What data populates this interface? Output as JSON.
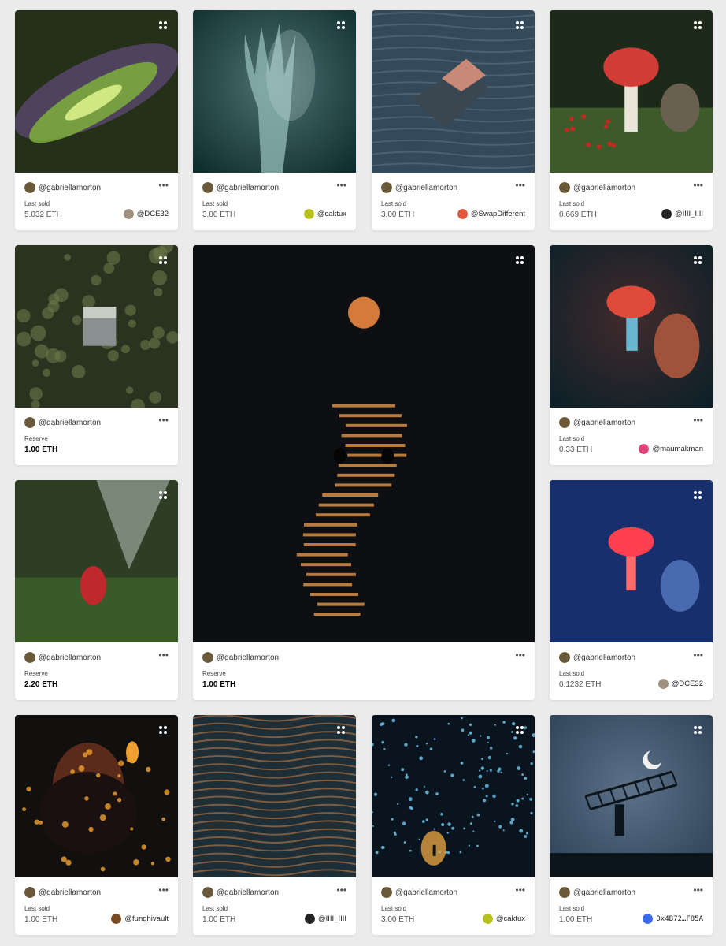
{
  "colors": {
    "background": "#ebebeb",
    "card": "#ffffff",
    "reserve_text": "#000000",
    "last_sold_text": "#555555"
  },
  "cards": [
    {
      "id": "aurora",
      "creator": "@gabriellamorton",
      "label": "Last sold",
      "price": "5.032 ETH",
      "owner": "@DCE32",
      "owner_avatar": "#a09080",
      "palette": [
        "#243018",
        "#7fae3c",
        "#6a4e8a"
      ],
      "art": "aurora"
    },
    {
      "id": "hand",
      "creator": "@gabriellamorton",
      "label": "Last sold",
      "price": "3.00 ETH",
      "owner": "@caktux",
      "owner_avatar": "#b8c020",
      "palette": [
        "#0f2e30",
        "#8fb6b4",
        "#163a3c"
      ],
      "art": "hand"
    },
    {
      "id": "bed-water",
      "creator": "@gabriellamorton",
      "label": "Last sold",
      "price": "3.00 ETH",
      "owner": "@SwapDifferent",
      "owner_avatar": "#e2583e",
      "palette": [
        "#344a5a",
        "#5d7282",
        "#c88a76"
      ],
      "art": "bed-water"
    },
    {
      "id": "mushroom-1",
      "creator": "@gabriellamorton",
      "label": "Last sold",
      "price": "0.669 ETH",
      "owner": "@IIII_IIII",
      "owner_avatar": "#222222",
      "palette": [
        "#1d2a1a",
        "#d23c36",
        "#3d5a2a"
      ],
      "art": "mushroom"
    },
    {
      "id": "bed-forest",
      "creator": "@gabriellamorton",
      "label": "Reserve",
      "price": "1.00 ETH",
      "owner": "",
      "owner_avatar": "",
      "palette": [
        "#2a3320",
        "#6d7a4a",
        "#c8ccc4"
      ],
      "art": "bed-forest"
    },
    {
      "id": "moon-sea",
      "creator": "@gabriellamorton",
      "label": "Reserve",
      "price": "1.00 ETH",
      "owner": "",
      "owner_avatar": "",
      "palette": [
        "#0d0f12",
        "#f0a050",
        "#c76a30"
      ],
      "art": "moon"
    },
    {
      "id": "mushroom-2",
      "creator": "@gabriellamorton",
      "label": "Last sold",
      "price": "0.33 ETH",
      "owner": "@maumakman",
      "owner_avatar": "#e0457a",
      "palette": [
        "#0d2028",
        "#e04a3a",
        "#6ab6d0"
      ],
      "art": "mushroom-glow"
    },
    {
      "id": "red-dress",
      "creator": "@gabriellamorton",
      "label": "Reserve",
      "price": "2.20 ETH",
      "owner": "",
      "owner_avatar": "",
      "palette": [
        "#2e3e24",
        "#c8d0cc",
        "#c0282e"
      ],
      "art": "red-dress"
    },
    {
      "id": "mushroom-3",
      "creator": "@gabriellamorton",
      "label": "Last sold",
      "price": "0.1232 ETH",
      "owner": "@DCE32",
      "owner_avatar": "#a09080",
      "palette": [
        "#0e1a3c",
        "#ff4050",
        "#2a5ac8"
      ],
      "art": "mushroom-blue"
    },
    {
      "id": "fire-boy",
      "creator": "@gabriellamorton",
      "label": "Last sold",
      "price": "1.00 ETH",
      "owner": "@funghivault",
      "owner_avatar": "#7a4a20",
      "palette": [
        "#12100e",
        "#f0a030",
        "#5a2a1a"
      ],
      "art": "fire"
    },
    {
      "id": "sand-water",
      "creator": "@gabriellamorton",
      "label": "Last sold",
      "price": "1.00 ETH",
      "owner": "@IIII_IIII",
      "owner_avatar": "#222222",
      "palette": [
        "#1d2e36",
        "#c8824a",
        "#2e4a56"
      ],
      "art": "ripples"
    },
    {
      "id": "glow-cave",
      "creator": "@gabriellamorton",
      "label": "Last sold",
      "price": "3.00 ETH",
      "owner": "@caktux",
      "owner_avatar": "#b8c020",
      "palette": [
        "#0a141e",
        "#6ec8f0",
        "#e0a040"
      ],
      "art": "cave"
    },
    {
      "id": "ladder-moon",
      "creator": "@gabriellamorton",
      "label": "Last sold",
      "price": "1.00 ETH",
      "owner": "0x4B72…F85A",
      "owner_avatar": "#3a6ae8",
      "palette": [
        "#2e4258",
        "#8aa2b8",
        "#0c141c"
      ],
      "art": "ladder"
    }
  ]
}
